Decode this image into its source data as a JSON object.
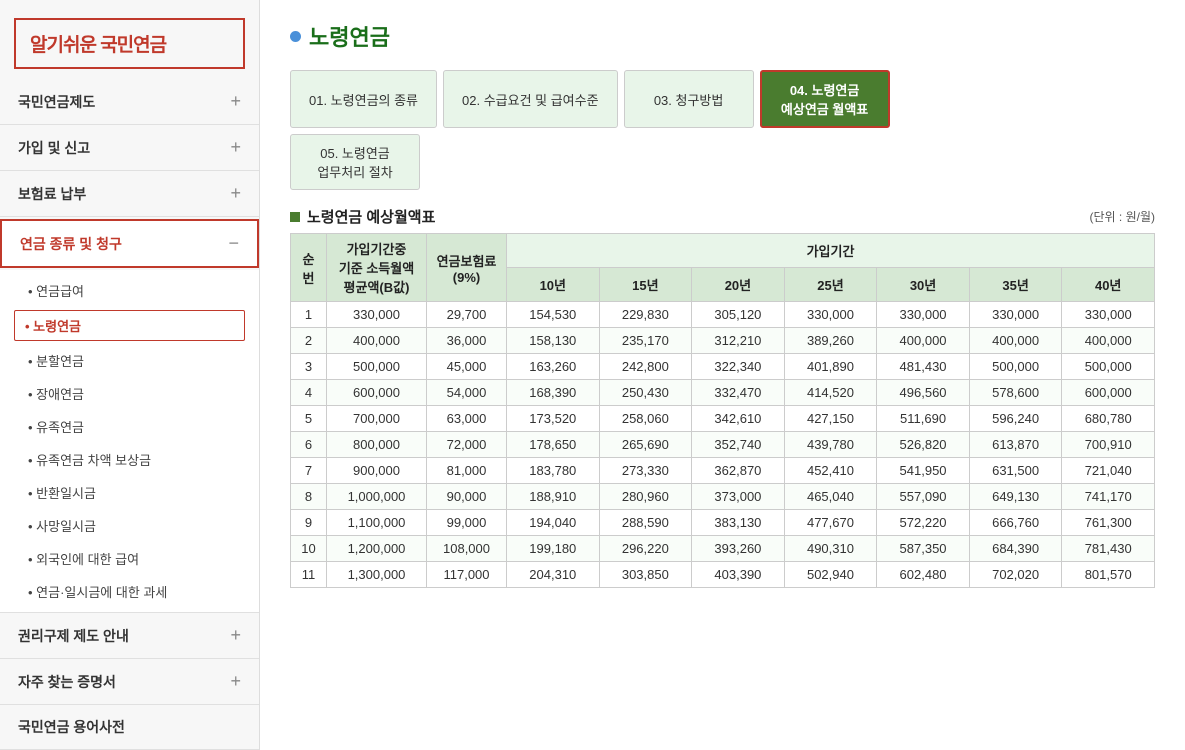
{
  "sidebar": {
    "logo": "알기쉬운 국민연금",
    "menus": [
      {
        "id": "national-pension-system",
        "label": "국민연금제도",
        "icon": "plus",
        "expanded": false
      },
      {
        "id": "join-report",
        "label": "가입 및 신고",
        "icon": "plus",
        "expanded": false
      },
      {
        "id": "insurance-payment",
        "label": "보험료 납부",
        "icon": "plus",
        "expanded": false
      },
      {
        "id": "pension-types",
        "label": "연금 종류 및 청구",
        "icon": "minus",
        "expanded": true,
        "highlighted": true
      },
      {
        "id": "rights-relief",
        "label": "권리구제 제도 안내",
        "icon": "plus",
        "expanded": false
      },
      {
        "id": "frequent-docs",
        "label": "자주 찾는 증명서",
        "icon": "plus",
        "expanded": false
      },
      {
        "id": "dictionary",
        "label": "국민연금 용어사전",
        "icon": "",
        "expanded": false
      }
    ],
    "sub_items": [
      {
        "id": "pension-benefits",
        "label": "• 연금급여",
        "active": false
      },
      {
        "id": "old-age-pension",
        "label": "• 노령연금",
        "active": true
      },
      {
        "id": "split-pension",
        "label": "• 분할연금",
        "active": false
      },
      {
        "id": "disability-pension",
        "label": "• 장애연금",
        "active": false
      },
      {
        "id": "survivor-pension",
        "label": "• 유족연금",
        "active": false
      },
      {
        "id": "survivor-compensation",
        "label": "• 유족연금 차액 보상금",
        "active": false
      },
      {
        "id": "return-lump",
        "label": "• 반환일시금",
        "active": false
      },
      {
        "id": "death-lump",
        "label": "• 사망일시금",
        "active": false
      },
      {
        "id": "foreigner-benefits",
        "label": "• 외국인에 대한 급여",
        "active": false
      },
      {
        "id": "tax-on-benefits",
        "label": "• 연금·일시금에 대한 과세",
        "active": false
      }
    ]
  },
  "main": {
    "page_title": "노령연금",
    "tabs": [
      {
        "id": "tab1",
        "label": "01. 노령연금의 종류",
        "active": false
      },
      {
        "id": "tab2",
        "label": "02. 수급요건 및 급여수준",
        "active": false
      },
      {
        "id": "tab3",
        "label": "03. 청구방법",
        "active": false
      },
      {
        "id": "tab4",
        "label": "04. 노령연금\n예상연금 월액표",
        "active": true
      },
      {
        "id": "tab5",
        "label": "05. 노령연금\n업무처리 절차",
        "active": false
      }
    ],
    "section_title": "노령연금 예상월액표",
    "section_unit": "(단위 : 원/월)",
    "table": {
      "headers_row1": [
        "순번",
        "가입기간중\n기준 소득월액\n평균액(B값)",
        "연금보험료\n(9%)",
        "가입기간"
      ],
      "headers_row2_years": [
        "10년",
        "15년",
        "20년",
        "25년",
        "30년",
        "35년",
        "40년"
      ],
      "rows": [
        {
          "num": 1,
          "income": "330,000",
          "premium": "29,700",
          "y10": "154,530",
          "y15": "229,830",
          "y20": "305,120",
          "y25": "330,000",
          "y30": "330,000",
          "y35": "330,000",
          "y40": "330,000"
        },
        {
          "num": 2,
          "income": "400,000",
          "premium": "36,000",
          "y10": "158,130",
          "y15": "235,170",
          "y20": "312,210",
          "y25": "389,260",
          "y30": "400,000",
          "y35": "400,000",
          "y40": "400,000"
        },
        {
          "num": 3,
          "income": "500,000",
          "premium": "45,000",
          "y10": "163,260",
          "y15": "242,800",
          "y20": "322,340",
          "y25": "401,890",
          "y30": "481,430",
          "y35": "500,000",
          "y40": "500,000"
        },
        {
          "num": 4,
          "income": "600,000",
          "premium": "54,000",
          "y10": "168,390",
          "y15": "250,430",
          "y20": "332,470",
          "y25": "414,520",
          "y30": "496,560",
          "y35": "578,600",
          "y40": "600,000"
        },
        {
          "num": 5,
          "income": "700,000",
          "premium": "63,000",
          "y10": "173,520",
          "y15": "258,060",
          "y20": "342,610",
          "y25": "427,150",
          "y30": "511,690",
          "y35": "596,240",
          "y40": "680,780"
        },
        {
          "num": 6,
          "income": "800,000",
          "premium": "72,000",
          "y10": "178,650",
          "y15": "265,690",
          "y20": "352,740",
          "y25": "439,780",
          "y30": "526,820",
          "y35": "613,870",
          "y40": "700,910"
        },
        {
          "num": 7,
          "income": "900,000",
          "premium": "81,000",
          "y10": "183,780",
          "y15": "273,330",
          "y20": "362,870",
          "y25": "452,410",
          "y30": "541,950",
          "y35": "631,500",
          "y40": "721,040"
        },
        {
          "num": 8,
          "income": "1,000,000",
          "premium": "90,000",
          "y10": "188,910",
          "y15": "280,960",
          "y20": "373,000",
          "y25": "465,040",
          "y30": "557,090",
          "y35": "649,130",
          "y40": "741,170"
        },
        {
          "num": 9,
          "income": "1,100,000",
          "premium": "99,000",
          "y10": "194,040",
          "y15": "288,590",
          "y20": "383,130",
          "y25": "477,670",
          "y30": "572,220",
          "y35": "666,760",
          "y40": "761,300"
        },
        {
          "num": 10,
          "income": "1,200,000",
          "premium": "108,000",
          "y10": "199,180",
          "y15": "296,220",
          "y20": "393,260",
          "y25": "490,310",
          "y30": "587,350",
          "y35": "684,390",
          "y40": "781,430"
        },
        {
          "num": 11,
          "income": "1,300,000",
          "premium": "117,000",
          "y10": "204,310",
          "y15": "303,850",
          "y20": "403,390",
          "y25": "502,940",
          "y30": "602,480",
          "y35": "702,020",
          "y40": "801,570"
        }
      ]
    }
  }
}
